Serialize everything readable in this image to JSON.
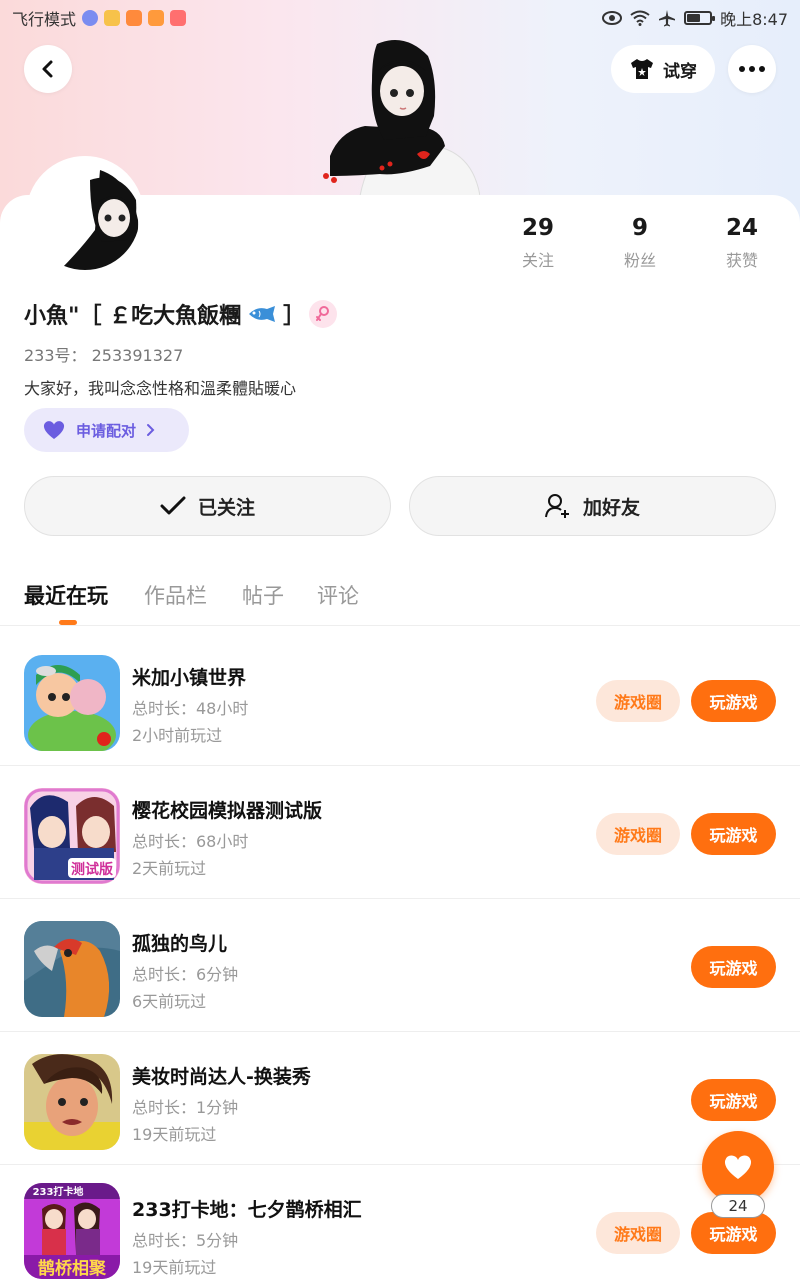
{
  "status_bar": {
    "airplane_mode": "飞行模式",
    "time": "晚上8:47"
  },
  "header": {
    "try_on_label": "试穿"
  },
  "stats": [
    {
      "value": "29",
      "label": "关注"
    },
    {
      "value": "9",
      "label": "粉丝"
    },
    {
      "value": "24",
      "label": "获赞"
    }
  ],
  "profile": {
    "nickname": "小魚\"［ ￡吃大魚飯糰",
    "nickname_end": "］",
    "uid": "233号： 253391327",
    "bio": "大家好，我叫念念性格和溫柔體貼暖心",
    "pair_label": "申请配对"
  },
  "actions": {
    "following_label": "已关注",
    "add_friend_label": "加好友"
  },
  "tabs": [
    "最近在玩",
    "作品栏",
    "帖子",
    "评论"
  ],
  "games": [
    {
      "title": "米加小镇世界",
      "duration": "总时长：48小时",
      "last_played": "2小时前玩过",
      "has_circle": true
    },
    {
      "title": "樱花校园模拟器测试版",
      "duration": "总时长：68小时",
      "last_played": "2天前玩过",
      "has_circle": true
    },
    {
      "title": "孤独的鸟儿",
      "duration": "总时长：6分钟",
      "last_played": "6天前玩过",
      "has_circle": false
    },
    {
      "title": "美妆时尚达人-换装秀",
      "duration": "总时长：1分钟",
      "last_played": "19天前玩过",
      "has_circle": false
    },
    {
      "title": "233打卡地：七夕鹊桥相汇",
      "duration": "总时长：5分钟",
      "last_played": "19天前玩过",
      "has_circle": true
    }
  ],
  "game_buttons": {
    "circle_label": "游戏圈",
    "play_label": "玩游戏"
  },
  "icon_texts": {
    "badge_test": "测试版",
    "game5_top": "233打卡地",
    "game5_bottom": "鹊桥相聚"
  },
  "fab": {
    "like_count": "24"
  },
  "colors": {
    "accent": "#ff6f0f",
    "accent_light": "#fde7da",
    "pair_bg": "#ebe9fb",
    "pair_text": "#6b5de0"
  }
}
